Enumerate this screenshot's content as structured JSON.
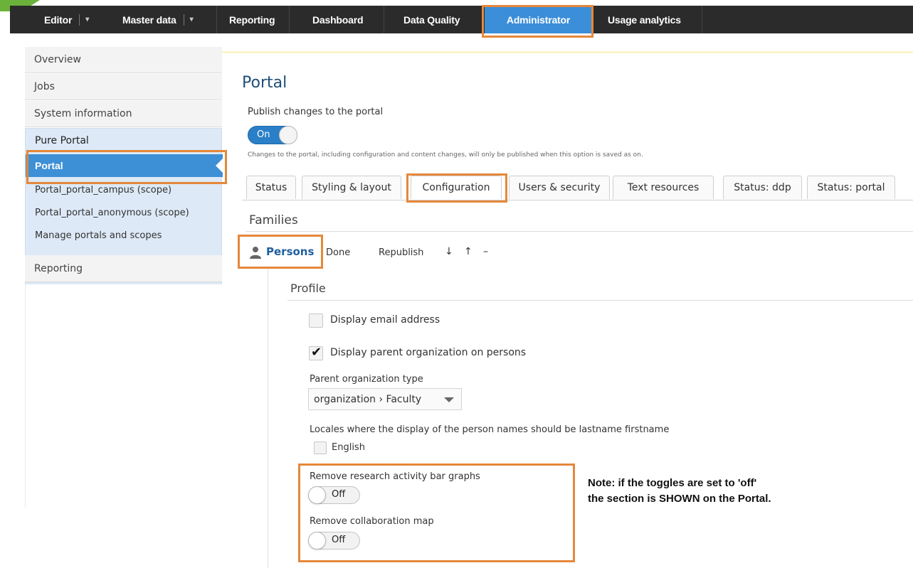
{
  "nav": {
    "editor": "Editor",
    "master_data": "Master data",
    "reporting": "Reporting",
    "dashboard": "Dashboard",
    "data_quality": "Data Quality",
    "administrator": "Administrator",
    "usage_analytics": "Usage analytics",
    "caret": "▾"
  },
  "sidebar": {
    "overview": "Overview",
    "jobs": "Jobs",
    "system_information": "System information",
    "pure_portal": "Pure Portal",
    "portal": "Portal",
    "portal_campus": "Portal_portal_campus (scope)",
    "portal_anonymous": "Portal_portal_anonymous (scope)",
    "manage_portals": "Manage portals and scopes",
    "reporting": "Reporting"
  },
  "main": {
    "title": "Portal",
    "publish_label": "Publish changes to the portal",
    "publish_toggle": "On",
    "publish_note": "Changes to the portal, including configuration and content changes, will only be published when this option is saved as on.",
    "tabs": {
      "status": "Status",
      "styling": "Styling & layout",
      "configuration": "Configuration",
      "users": "Users & security",
      "text_resources": "Text resources",
      "status_ddp": "Status: ddp",
      "status_portal": "Status: portal"
    },
    "families": "Families",
    "persons": "Persons",
    "done": "Done",
    "republish": "Republish",
    "move_down": "↓",
    "move_up": "↑",
    "remove": "–",
    "profile": "Profile",
    "display_email": "Display email address",
    "display_parent_org": "Display parent organization on persons",
    "parent_org_type_label": "Parent organization type",
    "parent_org_type_value": "organization › Faculty",
    "locales_label": "Locales where the display of the person names should be lastname firstname",
    "english": "English",
    "remove_bar_graphs": "Remove research activity bar graphs",
    "remove_bar_graphs_toggle": "Off",
    "remove_collab_map": "Remove collaboration map",
    "remove_collab_map_toggle": "Off",
    "display_email_checked": false,
    "display_parent_org_checked": true,
    "english_checked": false
  },
  "annotation": {
    "line1": "Note: if the toggles are set to 'off'",
    "line2": "the section is SHOWN on the Portal."
  },
  "colors": {
    "highlight": "#e5883a",
    "nav_bg": "#2b2b2b",
    "active_blue": "#3d8fd6"
  }
}
